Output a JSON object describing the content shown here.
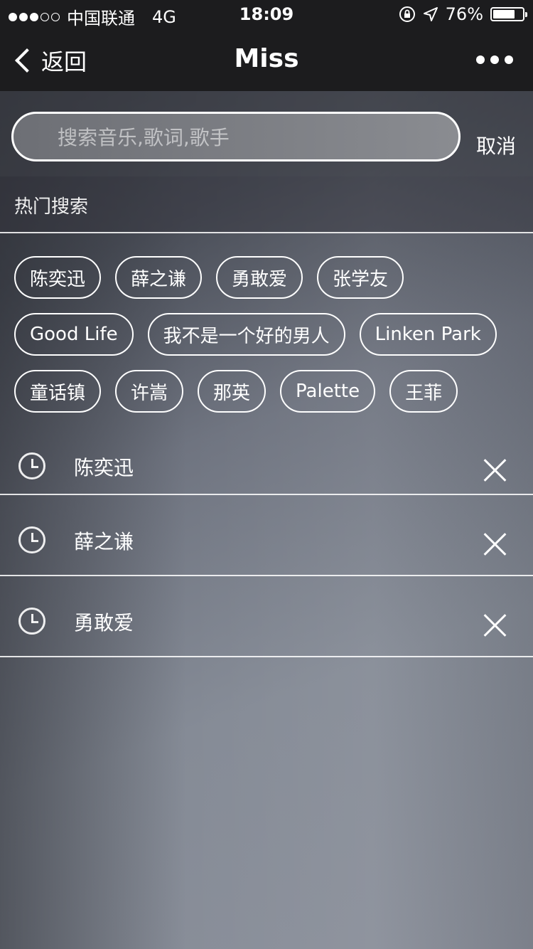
{
  "status_bar": {
    "carrier": "中国联通",
    "network": "4G",
    "time": "18:09",
    "battery_percent": "76%",
    "battery_level": 0.76,
    "signal_strength": 3,
    "signal_max": 5
  },
  "nav": {
    "back_label": "返回",
    "title": "Miss"
  },
  "search": {
    "placeholder": "搜索音乐,歌词,歌手",
    "value": "",
    "cancel_label": "取消"
  },
  "hot_search": {
    "header": "热门搜索",
    "tags": [
      [
        "陈奕迅",
        "薛之谦",
        "勇敢爱",
        "张学友"
      ],
      [
        "Good Life",
        "我不是一个好的男人",
        "Linken Park"
      ],
      [
        "童话镇",
        "许嵩",
        "那英",
        "Palette",
        "王菲"
      ]
    ]
  },
  "history": {
    "items": [
      "陈奕迅",
      "薛之谦",
      "勇敢爱"
    ]
  }
}
